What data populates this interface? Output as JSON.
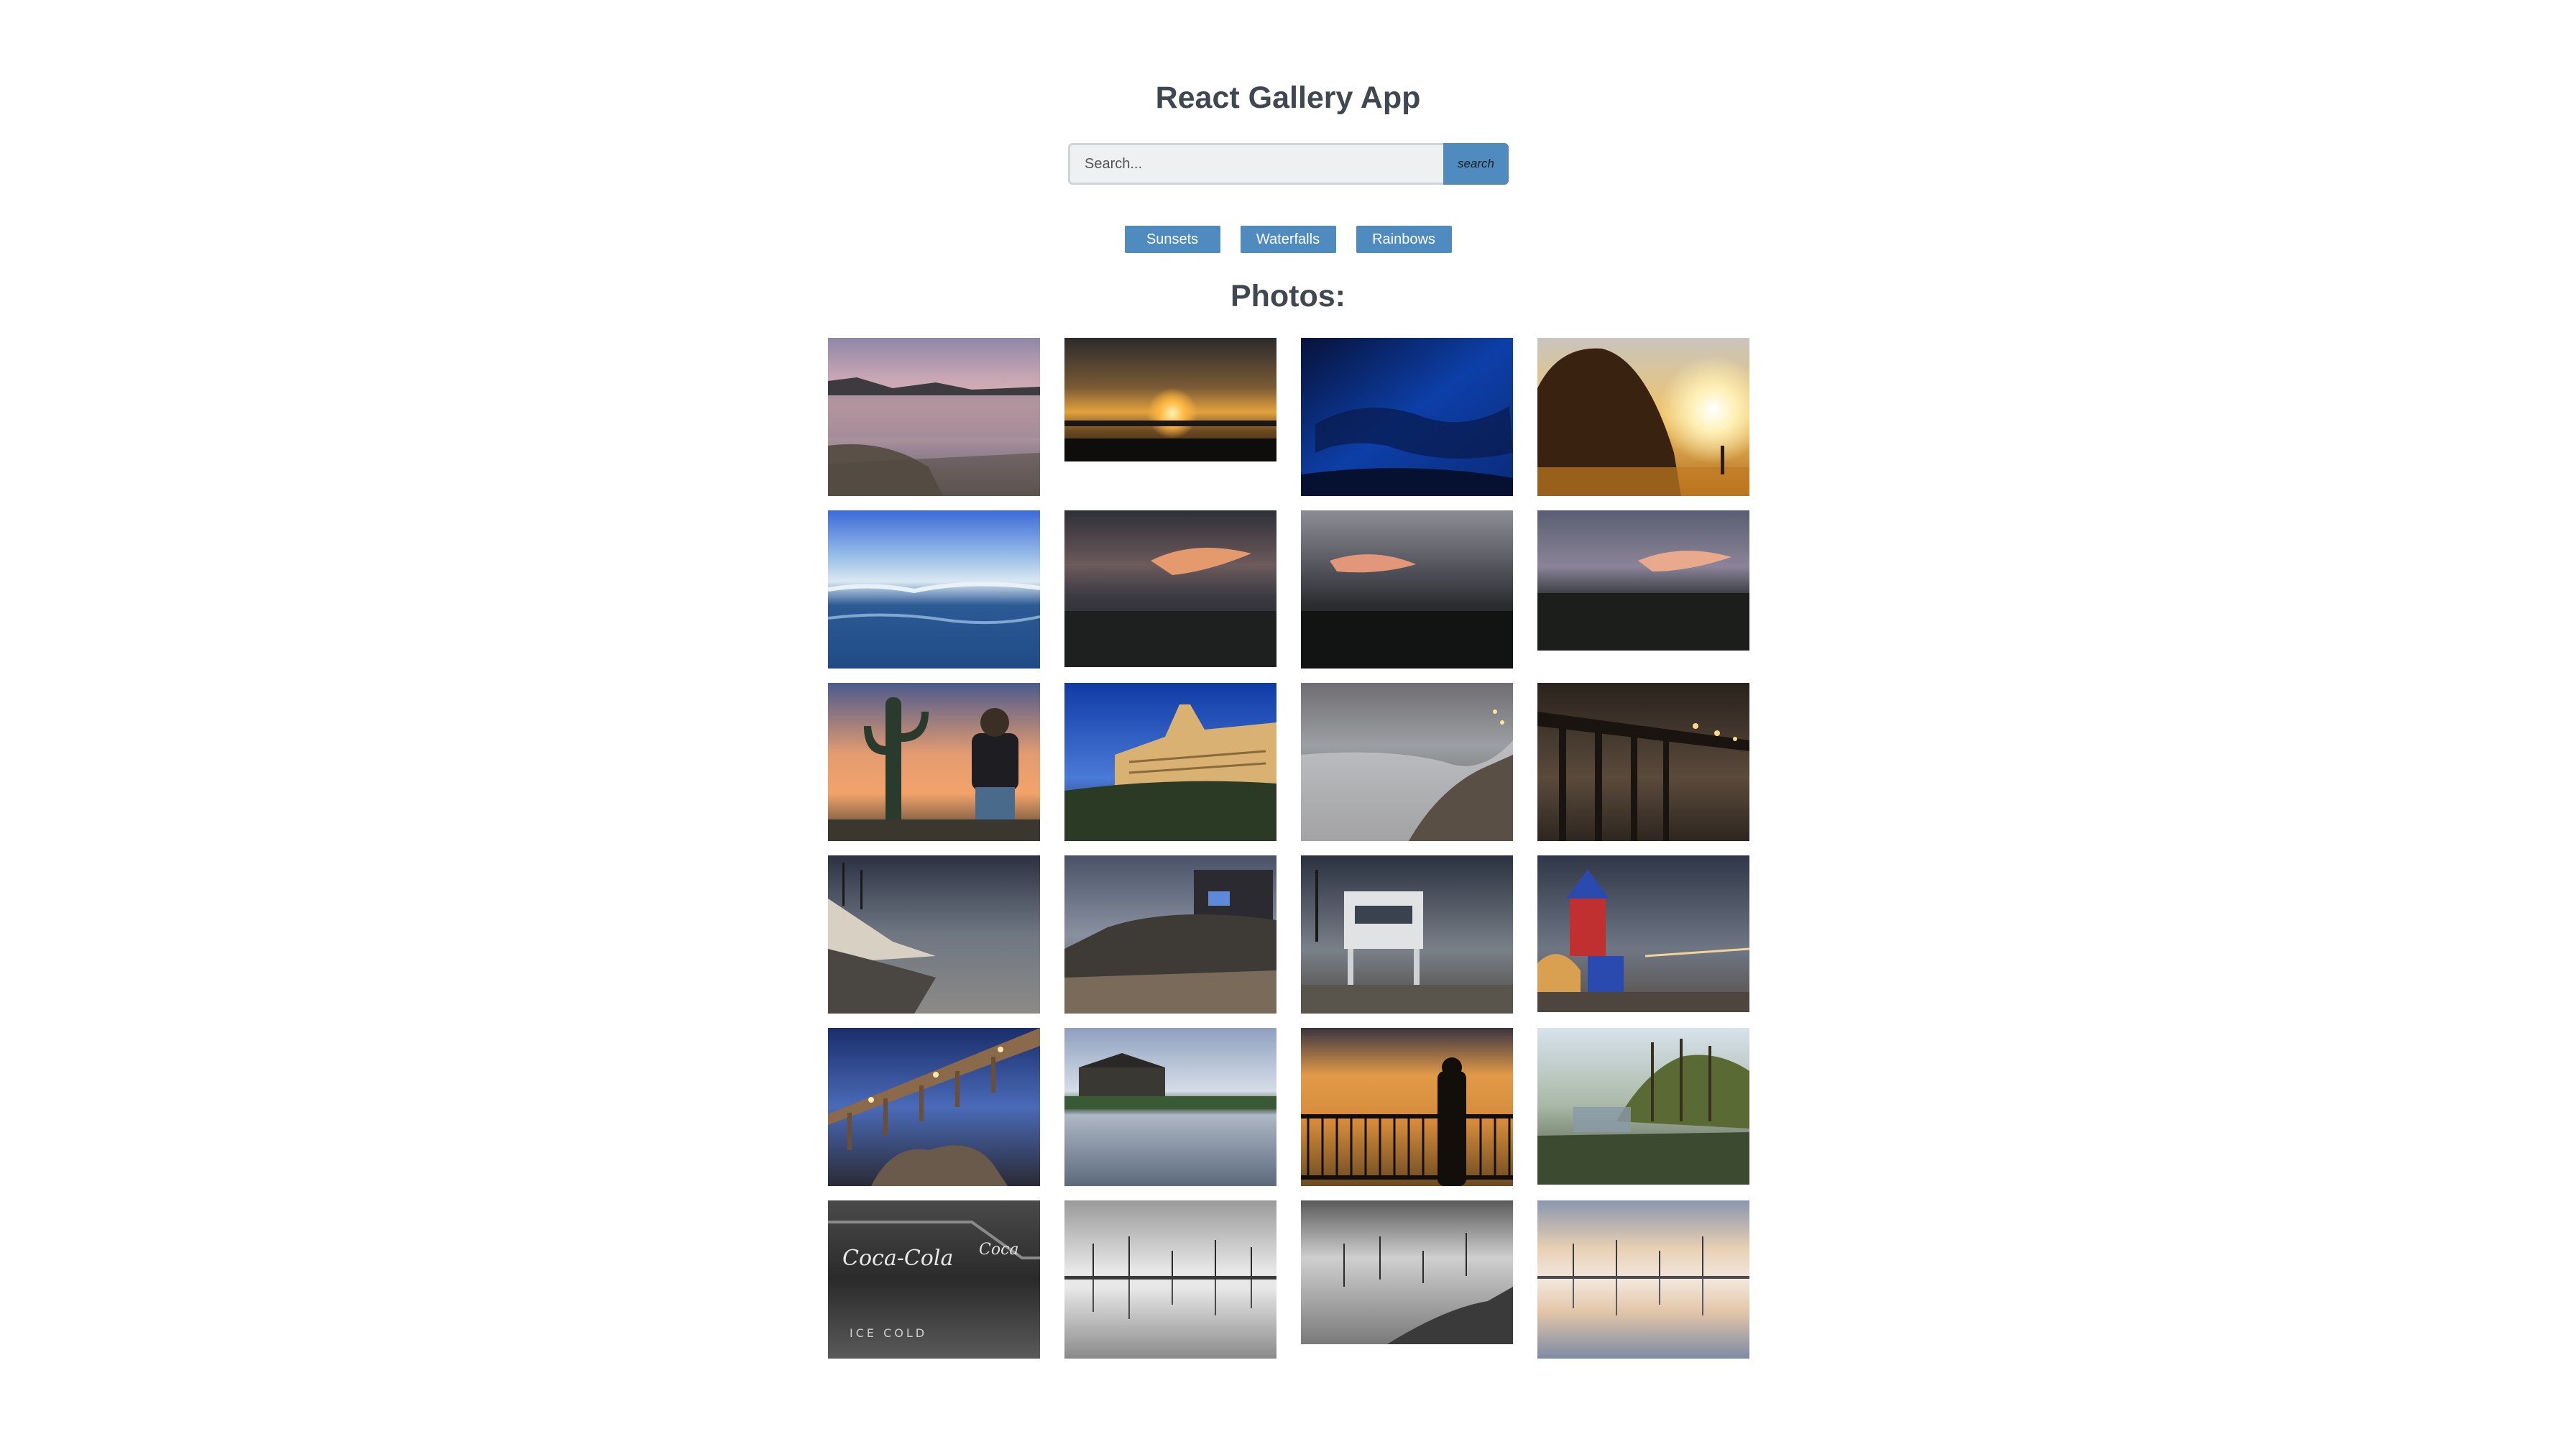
{
  "app": {
    "title": "React Gallery App"
  },
  "search": {
    "placeholder": "Search...",
    "button_label": "search"
  },
  "nav": {
    "items": [
      {
        "label": "Sunsets"
      },
      {
        "label": "Waterfalls"
      },
      {
        "label": "Rainbows"
      }
    ]
  },
  "photos": {
    "heading": "Photos:"
  },
  "colors": {
    "accent": "#4f8bbf",
    "text": "#3f4850",
    "input_bg": "#eef0f2"
  }
}
